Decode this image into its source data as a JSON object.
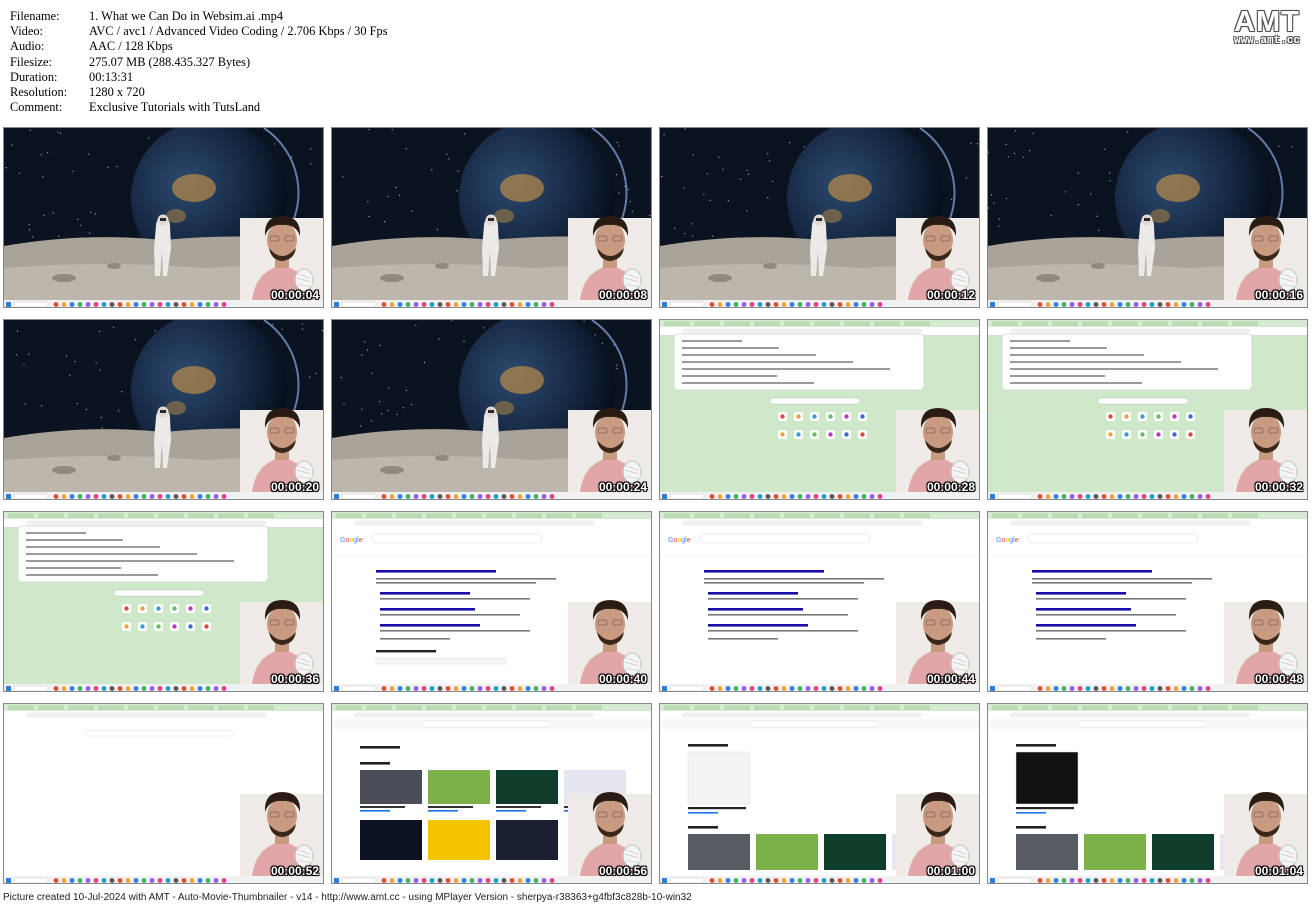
{
  "header": {
    "rows": [
      {
        "key": "Filename:",
        "value": "1. What we Can Do in Websim.ai .mp4"
      },
      {
        "key": "Video:",
        "value": "AVC / avc1 / Advanced Video Coding / 2.706 Kbps / 30 Fps"
      },
      {
        "key": "Audio:",
        "value": "AAC / 128 Kbps"
      },
      {
        "key": "Filesize:",
        "value": "275.07 MB (288.435.327 Bytes)"
      },
      {
        "key": "Duration:",
        "value": "00:13:31"
      },
      {
        "key": "Resolution:",
        "value": "1280 x 720"
      },
      {
        "key": "Comment:",
        "value": "Exclusive Tutorials with TutsLand"
      }
    ]
  },
  "logo": {
    "big": "AMT",
    "small": "www.amt.cc"
  },
  "colors": {
    "space": "#0b1220",
    "moon": "#a9a39a",
    "google_green": "#cfe8c9",
    "skin": "#c99a82",
    "shirt": "#e0a6a8"
  },
  "thumbnails": [
    {
      "time": "00:00:04",
      "scene": "space"
    },
    {
      "time": "00:00:08",
      "scene": "space"
    },
    {
      "time": "00:00:12",
      "scene": "space"
    },
    {
      "time": "00:00:16",
      "scene": "space"
    },
    {
      "time": "00:00:20",
      "scene": "space"
    },
    {
      "time": "00:00:24",
      "scene": "space"
    },
    {
      "time": "00:00:28",
      "scene": "newtab"
    },
    {
      "time": "00:00:32",
      "scene": "newtab"
    },
    {
      "time": "00:00:36",
      "scene": "newtab"
    },
    {
      "time": "00:00:40",
      "scene": "search"
    },
    {
      "time": "00:00:44",
      "scene": "search"
    },
    {
      "time": "00:00:48",
      "scene": "search"
    },
    {
      "time": "00:00:52",
      "scene": "blank"
    },
    {
      "time": "00:00:56",
      "scene": "websim"
    },
    {
      "time": "00:01:00",
      "scene": "websim"
    },
    {
      "time": "00:01:04",
      "scene": "websim"
    }
  ],
  "footer": "Picture created 10-Jul-2024 with AMT - Auto-Movie-Thumbnailer - v14 - http://www.amt.cc - using MPlayer Version - sherpya-r38363+g4fbf3c828b-10-win32"
}
